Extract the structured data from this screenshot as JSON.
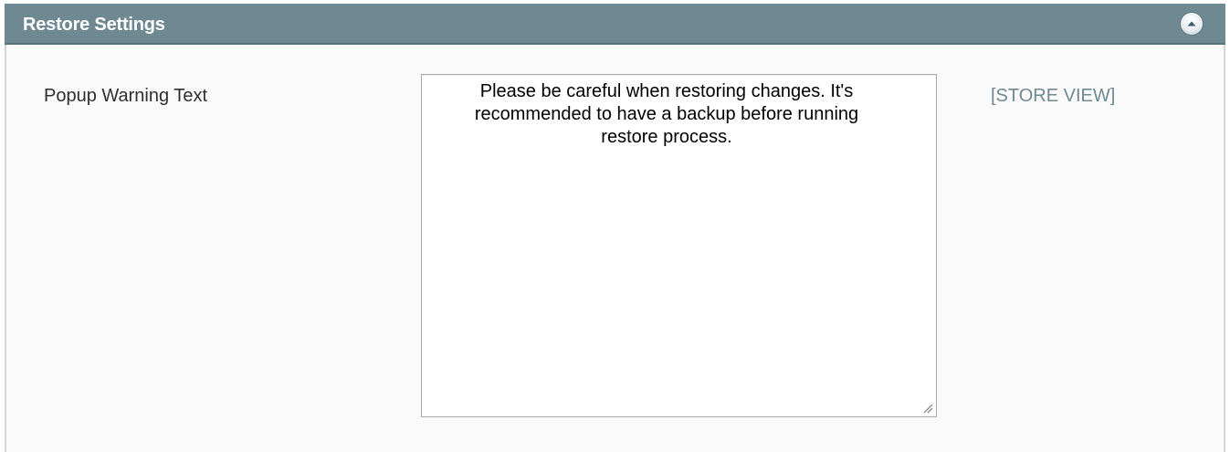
{
  "section": {
    "title": "Restore Settings",
    "collapse_icon": "chevron-up-circle-icon"
  },
  "field": {
    "label": "Popup Warning Text",
    "value": "Please be careful when restoring changes. It's\nrecommended to have a backup before running\nrestore process.",
    "scope": "[STORE VIEW]"
  },
  "colors": {
    "header_bg": "#6f8992",
    "panel_bg": "#fafafa",
    "scope_text": "#6f8992"
  }
}
